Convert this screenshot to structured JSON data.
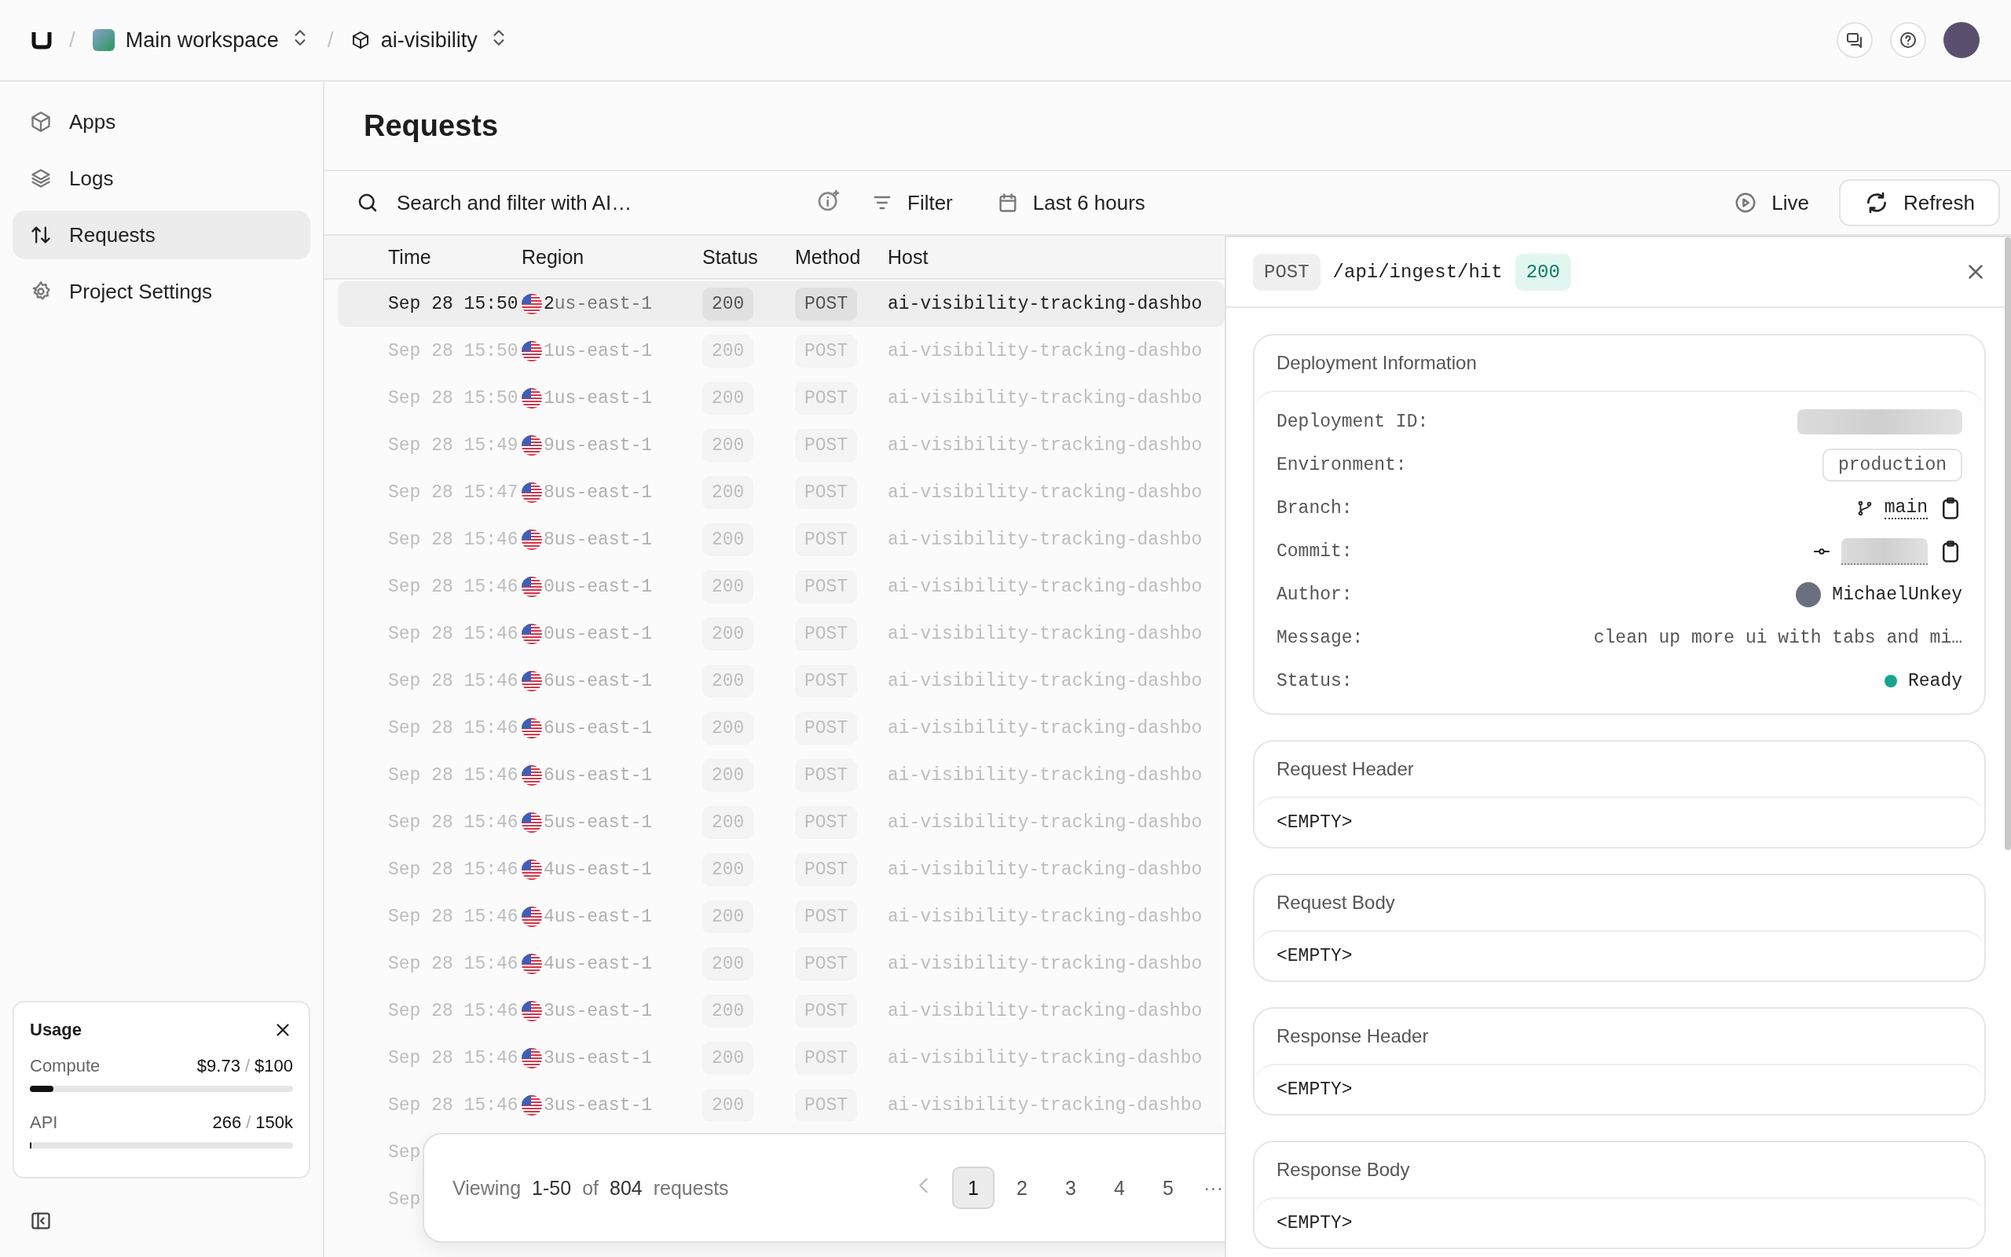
{
  "breadcrumb": {
    "separator": "/",
    "workspace": "Main workspace",
    "project": "ai-visibility"
  },
  "sidebar": {
    "items": [
      {
        "label": "Apps",
        "selected": false
      },
      {
        "label": "Logs",
        "selected": false
      },
      {
        "label": "Requests",
        "selected": true
      },
      {
        "label": "Project Settings",
        "selected": false
      }
    ]
  },
  "usage": {
    "title": "Usage",
    "meters": [
      {
        "label": "Compute",
        "used": "$9.73",
        "separator": "/",
        "limit": "$100",
        "level": 0.09
      },
      {
        "label": "API",
        "used": "266",
        "separator": "/",
        "limit": "150k",
        "level": 0.004
      }
    ]
  },
  "page": {
    "title": "Requests"
  },
  "toolbar": {
    "search": {
      "placeholder": "Search and filter with AI…"
    },
    "filter": "Filter",
    "time_range": "Last 6 hours",
    "live": "Live",
    "refresh": "Refresh"
  },
  "table": {
    "columns": [
      "Time",
      "Region",
      "Status",
      "Method",
      "Host"
    ],
    "rows": [
      {
        "time": "Sep 28 15:50",
        "time_end": "2",
        "region": "us-east-1",
        "status": "200",
        "method": "POST",
        "host": "ai-visibility-tracking-dashbo",
        "selected": true
      },
      {
        "time": "Sep 28 15:50",
        "time_end": "1",
        "region": "us-east-1",
        "status": "200",
        "method": "POST",
        "host": "ai-visibility-tracking-dashbo",
        "selected": false
      },
      {
        "time": "Sep 28 15:50",
        "time_end": "1",
        "region": "us-east-1",
        "status": "200",
        "method": "POST",
        "host": "ai-visibility-tracking-dashbo",
        "selected": false
      },
      {
        "time": "Sep 28 15:49",
        "time_end": "9",
        "region": "us-east-1",
        "status": "200",
        "method": "POST",
        "host": "ai-visibility-tracking-dashbo",
        "selected": false
      },
      {
        "time": "Sep 28 15:47",
        "time_end": "8",
        "region": "us-east-1",
        "status": "200",
        "method": "POST",
        "host": "ai-visibility-tracking-dashbo",
        "selected": false
      },
      {
        "time": "Sep 28 15:46",
        "time_end": "8",
        "region": "us-east-1",
        "status": "200",
        "method": "POST",
        "host": "ai-visibility-tracking-dashbo",
        "selected": false
      },
      {
        "time": "Sep 28 15:46",
        "time_end": "0",
        "region": "us-east-1",
        "status": "200",
        "method": "POST",
        "host": "ai-visibility-tracking-dashbo",
        "selected": false
      },
      {
        "time": "Sep 28 15:46",
        "time_end": "0",
        "region": "us-east-1",
        "status": "200",
        "method": "POST",
        "host": "ai-visibility-tracking-dashbo",
        "selected": false
      },
      {
        "time": "Sep 28 15:46",
        "time_end": "6",
        "region": "us-east-1",
        "status": "200",
        "method": "POST",
        "host": "ai-visibility-tracking-dashbo",
        "selected": false
      },
      {
        "time": "Sep 28 15:46",
        "time_end": "6",
        "region": "us-east-1",
        "status": "200",
        "method": "POST",
        "host": "ai-visibility-tracking-dashbo",
        "selected": false
      },
      {
        "time": "Sep 28 15:46",
        "time_end": "6",
        "region": "us-east-1",
        "status": "200",
        "method": "POST",
        "host": "ai-visibility-tracking-dashbo",
        "selected": false
      },
      {
        "time": "Sep 28 15:46",
        "time_end": "5",
        "region": "us-east-1",
        "status": "200",
        "method": "POST",
        "host": "ai-visibility-tracking-dashbo",
        "selected": false
      },
      {
        "time": "Sep 28 15:46",
        "time_end": "4",
        "region": "us-east-1",
        "status": "200",
        "method": "POST",
        "host": "ai-visibility-tracking-dashbo",
        "selected": false
      },
      {
        "time": "Sep 28 15:46",
        "time_end": "4",
        "region": "us-east-1",
        "status": "200",
        "method": "POST",
        "host": "ai-visibility-tracking-dashbo",
        "selected": false
      },
      {
        "time": "Sep 28 15:46",
        "time_end": "4",
        "region": "us-east-1",
        "status": "200",
        "method": "POST",
        "host": "ai-visibility-tracking-dashbo",
        "selected": false
      },
      {
        "time": "Sep 28 15:46",
        "time_end": "3",
        "region": "us-east-1",
        "status": "200",
        "method": "POST",
        "host": "ai-visibility-tracking-dashbo",
        "selected": false
      },
      {
        "time": "Sep 28 15:46",
        "time_end": "3",
        "region": "us-east-1",
        "status": "200",
        "method": "POST",
        "host": "ai-visibility-tracking-dashbo",
        "selected": false
      },
      {
        "time": "Sep 28 15:46",
        "time_end": "3",
        "region": "us-east-1",
        "status": "200",
        "method": "POST",
        "host": "ai-visibility-tracking-dashbo",
        "selected": false
      }
    ],
    "partial_rows": [
      "Sep",
      "Sep"
    ]
  },
  "pagination": {
    "viewing": "Viewing",
    "range": "1-50",
    "of": "of",
    "total": "804",
    "unit": "requests",
    "pages": [
      {
        "label": "1",
        "selected": true
      },
      {
        "label": "2",
        "selected": false
      },
      {
        "label": "3",
        "selected": false
      },
      {
        "label": "4",
        "selected": false
      },
      {
        "label": "5",
        "selected": false
      }
    ],
    "more": "···"
  },
  "details": {
    "method": "POST",
    "path": "/api/ingest/hit",
    "status": "200",
    "deployment": {
      "title": "Deployment Information",
      "fields": [
        {
          "kind": "blurred",
          "label": "Deployment ID:"
        },
        {
          "kind": "tag",
          "label": "Environment:",
          "value": "production"
        },
        {
          "kind": "branch",
          "label": "Branch:",
          "value": "main"
        },
        {
          "kind": "commit",
          "label": "Commit:"
        },
        {
          "kind": "author",
          "label": "Author:",
          "value": "MichaelUnkey"
        },
        {
          "kind": "text",
          "label": "Message:",
          "value": "clean up more ui with tabs and mi…"
        },
        {
          "kind": "status",
          "label": "Status:",
          "value": "Ready",
          "color": "#17a58c"
        }
      ]
    },
    "sections": [
      {
        "title": "Request Header",
        "body": "<EMPTY>"
      },
      {
        "title": "Request Body",
        "body": "<EMPTY>"
      },
      {
        "title": "Response Header",
        "body": "<EMPTY>"
      },
      {
        "title": "Response Body",
        "body": "<EMPTY>"
      }
    ]
  }
}
